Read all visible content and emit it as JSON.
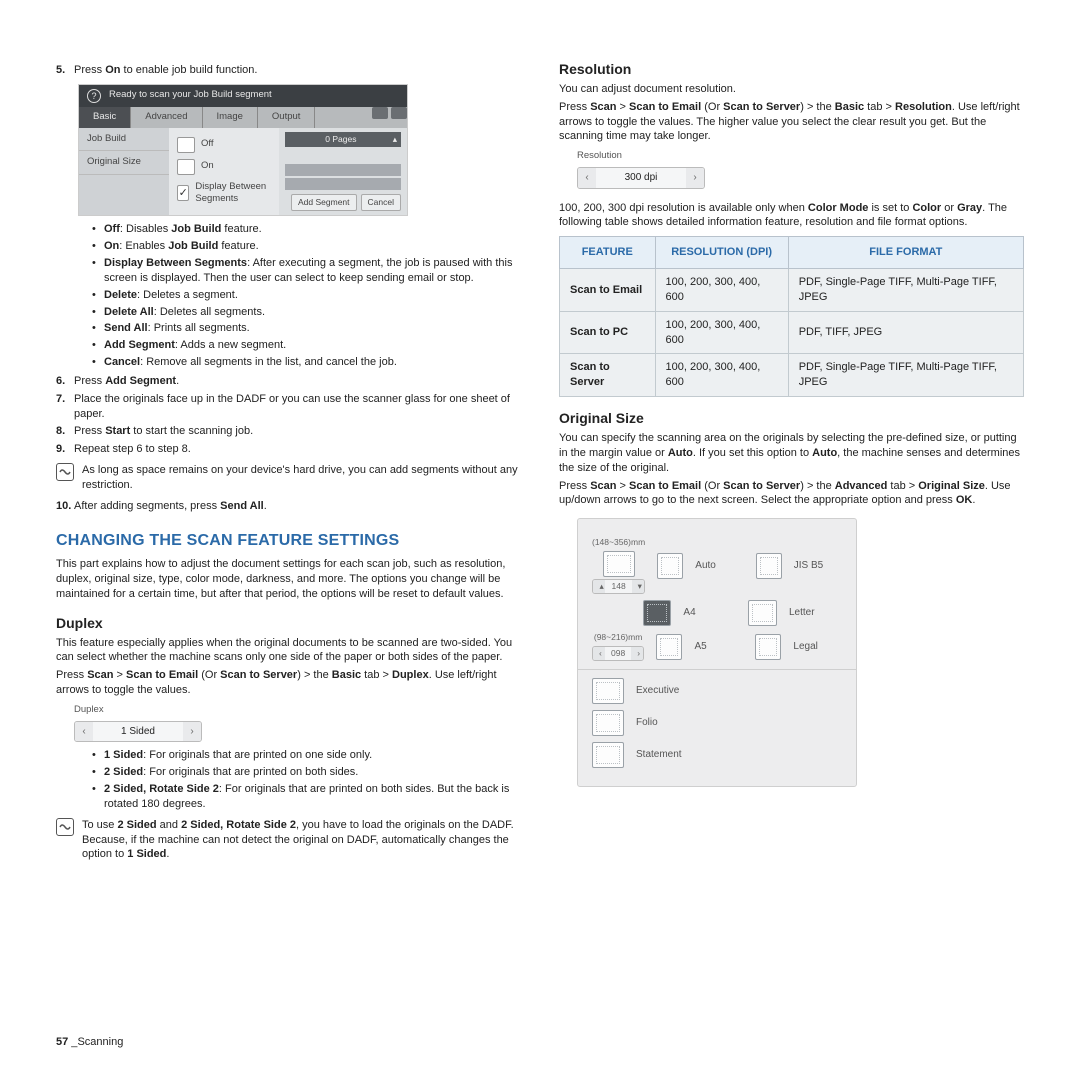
{
  "left": {
    "step5_pre": "Press ",
    "step5_b": "On",
    "step5_post": " to enable job build function.",
    "mock": {
      "title": "Ready to scan your Job Build segment",
      "tabs": [
        "Basic",
        "Advanced",
        "Image",
        "Output"
      ],
      "side": [
        "Job Build",
        "Original Size"
      ],
      "opts": [
        "Off",
        "On",
        "Display Between Segments"
      ],
      "pages": "0 Pages",
      "btns": [
        "Add Segment",
        "Cancel"
      ]
    },
    "jb_off_b": "Off",
    "jb_off_t": ": Disables ",
    "jb_off_b2": "Job Build",
    "jb_off_t2": " feature.",
    "jb_on_b": "On",
    "jb_on_t": ": Enables ",
    "jb_on_b2": "Job Build",
    "jb_on_t2": " feature.",
    "jb_dbs_b": "Display Between Segments",
    "jb_dbs_t": ": After executing a segment, the job is paused with this screen is displayed. Then the user can select to keep sending email or stop.",
    "jb_del_b": "Delete",
    "jb_del_t": ": Deletes a segment.",
    "jb_delall_b": "Delete All",
    "jb_delall_t": ": Deletes all segments.",
    "jb_sendall_b": "Send All",
    "jb_sendall_t": ": Prints all segments.",
    "jb_addseg_b": "Add Segment",
    "jb_addseg_t": ": Adds a new segment.",
    "jb_cancel_b": "Cancel",
    "jb_cancel_t": ": Remove all segments in the list, and cancel the job.",
    "s6_pre": "Press ",
    "s6_b": "Add Segment",
    "s6_post": ".",
    "s7": "Place the originals face up in the DADF or you can use the scanner glass for one sheet of paper.",
    "s8_pre": "Press ",
    "s8_b": "Start",
    "s8_post": " to start the scanning job.",
    "s9": "Repeat step 6 to step 8.",
    "note1": "As long as space remains on your device's hard drive, you can add segments without any restriction.",
    "s10_pre": "After adding segments, press ",
    "s10_b": "Send All",
    "s10_post": ".",
    "changing_h": "CHANGING THE SCAN FEATURE SETTINGS",
    "changing_p": "This part explains how to adjust the document settings for each scan job, such as resolution, duplex, original size, type, color mode, darkness, and more. The options you change will be maintained for a certain time, but after that period, the options will be reset to default values.",
    "duplex_h": "Duplex",
    "duplex_p": "This feature especially applies when the original documents to be scanned are two-sided. You can select whether the machine scans only one side of the paper or both sides of the paper.",
    "duplex_path_pre": "Press ",
    "duplex_path_1": "Scan",
    "duplex_gt1": " > ",
    "duplex_path_2": "Scan to Email",
    "duplex_or": " (Or ",
    "duplex_path_3": "Scan to Server",
    "duplex_orend": ") > the ",
    "duplex_path_4": "Basic",
    "duplex_tab": " tab > ",
    "duplex_path_5": "Duplex",
    "duplex_path_post": ". Use left/right arrows to toggle the values.",
    "duplex_spin_label": "Duplex",
    "duplex_spin_val": "1 Sided",
    "d1_b": "1 Sided",
    "d1_t": ": For originals that are printed on one side only.",
    "d2_b": "2 Sided",
    "d2_t": ": For originals that are printed on both sides.",
    "d3_b": "2 Sided, Rotate Side 2",
    "d3_t": ": For originals that are printed on both sides. But the back is rotated 180 degrees.",
    "note2_pre": "To use ",
    "note2_b1": "2 Sided",
    "note2_mid": " and ",
    "note2_b2": "2 Sided, Rotate Side 2",
    "note2_post1": ", you have to load the originals on the DADF. Because, if the machine can not detect the original on DADF, automatically changes the option to ",
    "note2_b3": "1 Sided",
    "note2_end": "."
  },
  "right": {
    "res_h": "Resolution",
    "res_p1": "You can adjust document resolution.",
    "res_path_pre": "Press ",
    "res_1": "Scan",
    "res_gt1": " > ",
    "res_2": "Scan to Email",
    "res_or": " (Or ",
    "res_3": "Scan to Server",
    "res_orend": ") > the ",
    "res_4": "Basic",
    "res_tab": " tab > ",
    "res_5": "Resolution",
    "res_path_post": ". Use left/right arrows to toggle the values. The higher value you select the clear result you get. But the scanning time may take longer.",
    "res_spin_label": "Resolution",
    "res_spin_val": "300 dpi",
    "res_p2_pre": "100, 200, 300 dpi resolution is available only when ",
    "res_p2_b1": "Color Mode",
    "res_p2_mid": " is set to ",
    "res_p2_b2": "Color",
    "res_p2_or": " or ",
    "res_p2_b3": "Gray",
    "res_p2_post": ". The following table shows detailed information feature, resolution and file format options.",
    "table_h1": "FEATURE",
    "table_h2": "RESOLUTION (DPI)",
    "table_h3": "FILE FORMAT",
    "r1c1": "Scan to Email",
    "r1c2": "100, 200, 300, 400, 600",
    "r1c3": "PDF, Single-Page TIFF, Multi-Page TIFF, JPEG",
    "r2c1": "Scan to PC",
    "r2c2": "100, 200, 300, 400, 600",
    "r2c3": "PDF, TIFF, JPEG",
    "r3c1": "Scan to Server",
    "r3c2": "100, 200, 300, 400, 600",
    "r3c3": "PDF, Single-Page TIFF, Multi-Page TIFF, JPEG",
    "os_h": "Original Size",
    "os_p1_pre": "You can specify the scanning area on the originals by selecting the pre-defined size, or putting in the margin value or ",
    "os_p1_b": "Auto",
    "os_p1_post": ". If you set this option to ",
    "os_p1_b2": "Auto",
    "os_p1_end": ", the machine senses and determines the size of the original.",
    "os_path_pre": "Press ",
    "os_1": "Scan",
    "os_gt1": " > ",
    "os_2": "Scan to Email",
    "os_or": " (Or ",
    "os_3": "Scan to Server",
    "os_orend": ") > the ",
    "os_4": "Advanced",
    "os_tab": " tab > ",
    "os_5": "Original Size",
    "os_path_post": ". Use up/down arrows to go to the next screen. Select the appropriate option and press ",
    "os_6": "OK",
    "os_end": ".",
    "os_mock": {
      "dim1": "(148~356)mm",
      "dim1v": "148",
      "dim2": "(98~216)mm",
      "dim2v": "098",
      "c1": "Auto",
      "c2": "A4",
      "c3": "A5",
      "c4": "JIS B5",
      "c5": "Letter",
      "c6": "Legal",
      "c7": "Executive",
      "c8": "Folio",
      "c9": "Statement"
    }
  },
  "footer_page": "57",
  "footer_sep": " _",
  "footer_label": "Scanning"
}
